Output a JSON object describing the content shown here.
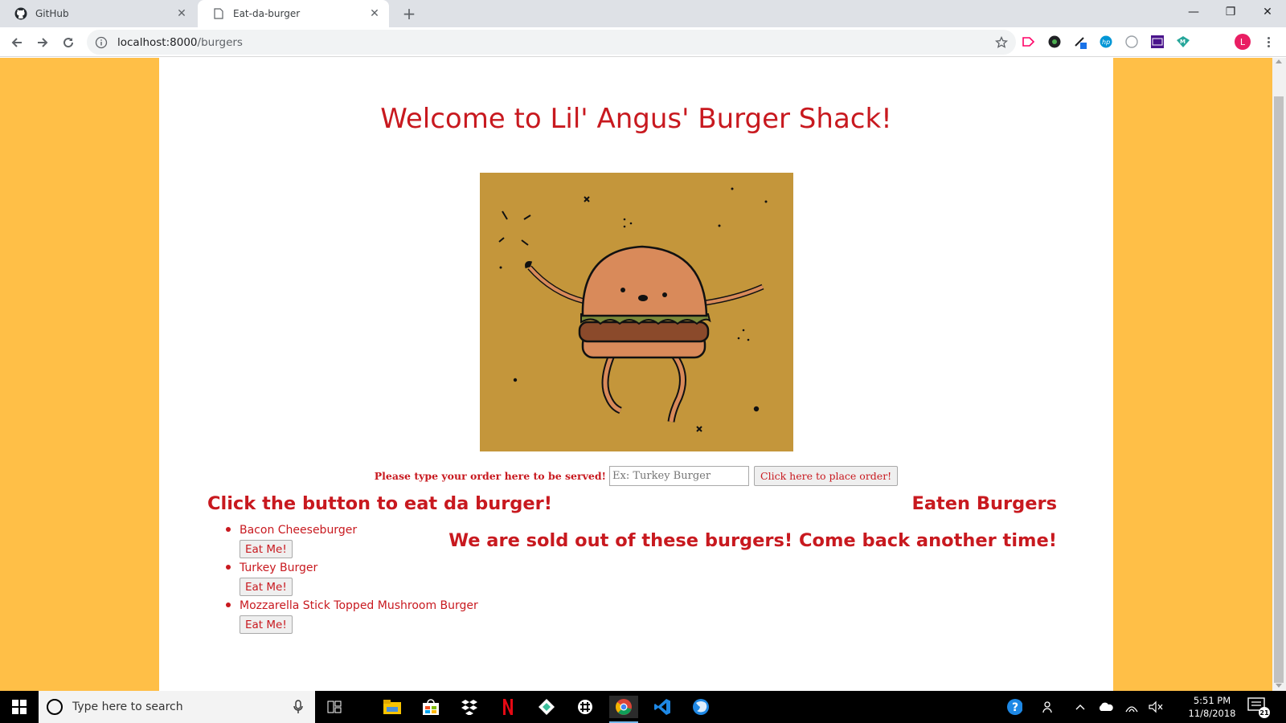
{
  "browser": {
    "tabs": [
      {
        "title": "GitHub",
        "icon": "github-icon",
        "active": false
      },
      {
        "title": "Eat-da-burger",
        "icon": "page-icon",
        "active": true
      }
    ],
    "url_host": "localhost:8000",
    "url_path": "/burgers"
  },
  "page": {
    "title": "Welcome to Lil' Angus' Burger Shack!",
    "hero_alt": "dancing-burger-illustration",
    "order_label": "Please type your order here to be served!",
    "order_placeholder": "Ex: Turkey Burger",
    "order_button": "Click here to place order!",
    "left_heading": "Click the button to eat da burger!",
    "right_heading": "Eaten Burgers",
    "sold_out_message": "We are sold out of these burgers! Come back another time!",
    "burgers": [
      {
        "name": "Bacon Cheeseburger",
        "button": "Eat Me!"
      },
      {
        "name": "Turkey Burger",
        "button": "Eat Me!"
      },
      {
        "name": "Mozzarella Stick Topped Mushroom Burger",
        "button": "Eat Me!"
      }
    ]
  },
  "taskbar": {
    "search_placeholder": "Type here to search",
    "time": "5:51 PM",
    "date": "11/8/2018",
    "notification_count": "21"
  },
  "colors": {
    "background": "#ffbf47",
    "accent_text": "#c8191f",
    "panel": "#ffffff"
  }
}
